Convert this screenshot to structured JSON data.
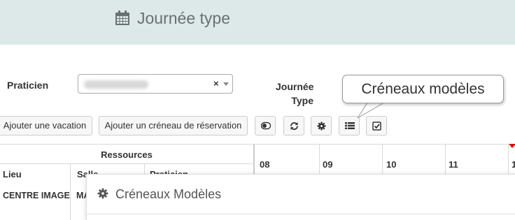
{
  "header": {
    "title": "Journée type",
    "icon": "calendar-icon"
  },
  "filters": {
    "praticien_label": "Praticien",
    "praticien_clear": "×",
    "journee_label_line1": "Journée",
    "journee_label_line2": "Type"
  },
  "toolbar": {
    "add_vacation_label": "Ajouter une vacation",
    "add_creneau_label": "Ajouter un créneau de réservation",
    "icons": [
      "toggle-icon",
      "refresh-icon",
      "gear-icon",
      "list-icon",
      "checkbox-icon"
    ]
  },
  "tooltip": {
    "text": "Créneaux modèles"
  },
  "table": {
    "resources_title": "Ressources",
    "columns": [
      "Lieu",
      "Salle",
      "Praticien"
    ],
    "hours": [
      "08",
      "09",
      "10",
      "11",
      "1"
    ],
    "rows": [
      {
        "lieu": "CENTRE IMAGE",
        "salle": "MA"
      }
    ]
  },
  "modal": {
    "title": "Créneaux Modèles",
    "icon": "gear-icon"
  },
  "colors": {
    "header_bg": "#dde9e9",
    "marker": "#e00000"
  }
}
